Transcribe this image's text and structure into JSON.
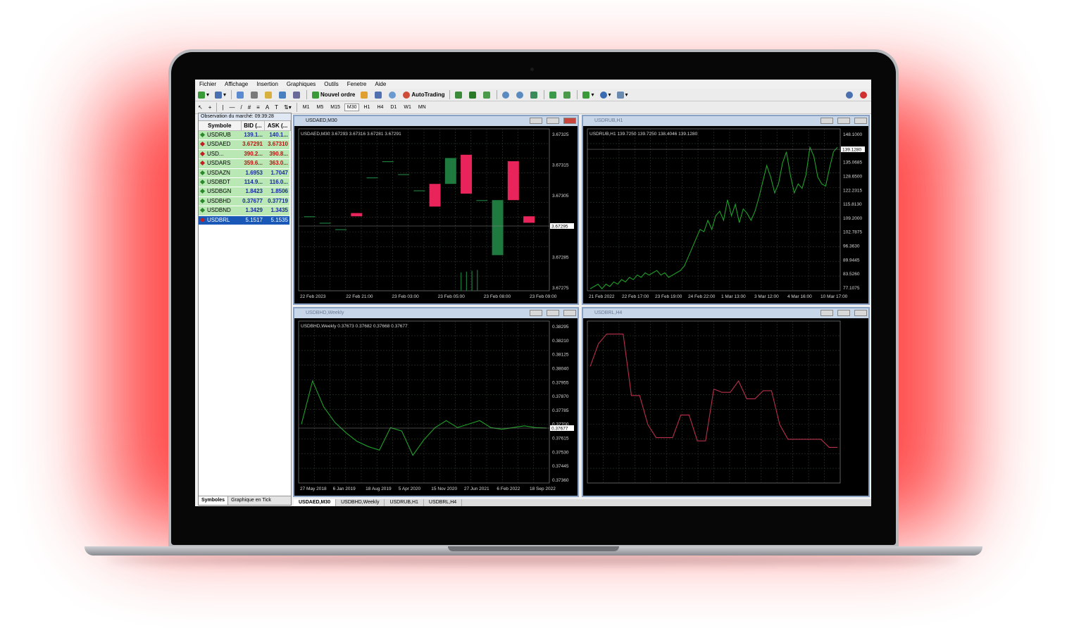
{
  "menu": [
    "Fichier",
    "Affichage",
    "Insertion",
    "Graphiques",
    "Outils",
    "Fenetre",
    "Aide"
  ],
  "toolbar": {
    "new_order": "Nouvel ordre",
    "autotrading": "AutoTrading"
  },
  "timeframes": [
    "M1",
    "M5",
    "M15",
    "M30",
    "H1",
    "H4",
    "D1",
    "W1",
    "MN"
  ],
  "market_watch": {
    "title": "Observation du marché: 09:39:28",
    "headers": [
      "Symbole",
      "BID (...",
      "ASK (..."
    ],
    "rows": [
      {
        "symbol": "USDRUB",
        "bid": "139.1...",
        "ask": "140.1...",
        "dir": "up"
      },
      {
        "symbol": "USDAED",
        "bid": "3.67291",
        "ask": "3.67310",
        "dir": "down"
      },
      {
        "symbol": "USD...",
        "bid": "390.2...",
        "ask": "390.8...",
        "dir": "down"
      },
      {
        "symbol": "USDARS",
        "bid": "359.6...",
        "ask": "363.0...",
        "dir": "down"
      },
      {
        "symbol": "USDAZN",
        "bid": "1.6953",
        "ask": "1.7047",
        "dir": "up"
      },
      {
        "symbol": "USDBDT",
        "bid": "114.9...",
        "ask": "116.0...",
        "dir": "up"
      },
      {
        "symbol": "USDBGN",
        "bid": "1.8423",
        "ask": "1.8506",
        "dir": "up"
      },
      {
        "symbol": "USDBHD",
        "bid": "0.37677",
        "ask": "0.37719",
        "dir": "up"
      },
      {
        "symbol": "USDBND",
        "bid": "1.3429",
        "ask": "1.3435",
        "dir": "up"
      },
      {
        "symbol": "USDBRL",
        "bid": "5.1517",
        "ask": "5.1535",
        "dir": "down",
        "selected": true
      }
    ],
    "tabs": [
      "Symboles",
      "Graphique en Tick"
    ]
  },
  "bottom_tabs": [
    "USDAED,M30",
    "USDBHD,Weekly",
    "USDRUB,H1",
    "USDBRL,H4"
  ],
  "colors": {
    "bull": "#1e7a3e",
    "bear": "#e8245a",
    "line_green": "#1fa02a",
    "line_red": "#b8304a",
    "grid": "#2b3b2b"
  },
  "chart_data": [
    {
      "type": "candlestick",
      "window_title": "USDAED,M30",
      "info": "USDAED,M30  3.67293 3.67316 3.67281 3.67291",
      "ylim": [
        3.67275,
        3.67325
      ],
      "y_ticks": [
        "3.67325",
        "3.67315",
        "3.67305",
        "3.67295",
        "3.67285",
        "3.67275"
      ],
      "x_ticks": [
        "22 Feb 2023",
        "22 Feb 21:00",
        "23 Feb 03:00",
        "23 Feb 05:00",
        "23 Feb 08:00",
        "23 Feb 09:00"
      ],
      "current_price": "3.67295",
      "candles": [
        {
          "o": 3.67298,
          "c": 3.67298
        },
        {
          "o": 3.67296,
          "c": 3.67296
        },
        {
          "o": 3.67294,
          "c": 3.67294
        },
        {
          "o": 3.67299,
          "c": 3.67298
        },
        {
          "o": 3.6731,
          "c": 3.6731
        },
        {
          "o": 3.67315,
          "c": 3.67315
        },
        {
          "o": 3.67311,
          "c": 3.67311
        },
        {
          "o": 3.67306,
          "c": 3.67306
        },
        {
          "o": 3.67308,
          "c": 3.67301
        },
        {
          "o": 3.67308,
          "c": 3.67316
        },
        {
          "o": 3.67317,
          "c": 3.67305
        },
        {
          "o": 3.67303,
          "c": 3.67303
        },
        {
          "o": 3.67286,
          "c": 3.67303
        },
        {
          "o": 3.67315,
          "c": 3.67303
        },
        {
          "o": 3.67298,
          "c": 3.67296
        }
      ]
    },
    {
      "type": "line",
      "window_title": "USDRUB,H1",
      "info": "USDRUB,H1  139.7250 139.7250 138.4046 139.1280",
      "ylim": [
        77.1075,
        148.1
      ],
      "y_ticks": [
        "148.1000",
        "141.4870",
        "135.0685",
        "128.6500",
        "122.2315",
        "115.8130",
        "109.2000",
        "102.7875",
        "96.3630",
        "89.9445",
        "83.5260",
        "77.1075"
      ],
      "x_ticks": [
        "21 Feb 2022",
        "22 Feb 17:00",
        "23 Feb 19:00",
        "24 Feb 22:00",
        "1 Mar 13:00",
        "3 Mar 12:00",
        "4 Mar 16:00",
        "10 Mar 17:00"
      ],
      "current_price": "139.1280",
      "values": [
        78,
        79,
        80,
        78,
        80,
        79,
        81,
        80,
        82,
        81,
        83,
        82,
        84,
        83,
        85,
        84,
        85,
        86,
        84,
        85,
        83,
        84,
        85,
        86,
        88,
        92,
        96,
        100,
        104,
        103,
        108,
        104,
        110,
        112,
        108,
        117,
        110,
        115,
        107,
        113,
        111,
        108,
        112,
        118,
        125,
        132,
        127,
        120,
        124,
        133,
        138,
        128,
        120,
        124,
        122,
        128,
        140,
        136,
        127,
        124,
        123,
        131,
        138,
        140
      ],
      "color": "#1fa02a"
    },
    {
      "type": "line",
      "window_title": "USDBHD,Weekly",
      "info": "USDBHD,Weekly  0.37673 0.37682 0.37668 0.37677",
      "ylim": [
        0.3736,
        0.38295
      ],
      "y_ticks": [
        "0.38295",
        "0.38210",
        "0.38125",
        "0.38040",
        "0.37955",
        "0.37870",
        "0.37785",
        "0.37700",
        "0.37615",
        "0.37530",
        "0.37445",
        "0.37360"
      ],
      "x_ticks": [
        "27 May 2018",
        "6 Jan 2019",
        "18 Aug 2019",
        "5 Apr 2020",
        "15 Nov 2020",
        "27 Jun 2021",
        "6 Feb 2022",
        "18 Sep 2022"
      ],
      "current_price": "0.37677",
      "values": [
        0.377,
        0.3795,
        0.378,
        0.3771,
        0.3765,
        0.376,
        0.3757,
        0.3755,
        0.3768,
        0.3766,
        0.3752,
        0.3761,
        0.3768,
        0.3772,
        0.3768,
        0.377,
        0.3772,
        0.3768,
        0.3767,
        0.3768,
        0.3769,
        0.3768,
        0.37677
      ],
      "color": "#1fa02a"
    },
    {
      "type": "line",
      "window_title": "USDBRL,H4",
      "ylim": [
        0,
        1
      ],
      "values": [
        0.72,
        0.86,
        0.92,
        0.92,
        0.92,
        0.54,
        0.54,
        0.36,
        0.28,
        0.28,
        0.28,
        0.42,
        0.42,
        0.26,
        0.26,
        0.58,
        0.56,
        0.56,
        0.63,
        0.52,
        0.52,
        0.57,
        0.57,
        0.36,
        0.27,
        0.27,
        0.27,
        0.27,
        0.27,
        0.22,
        0.22
      ],
      "color": "#b8304a"
    }
  ]
}
